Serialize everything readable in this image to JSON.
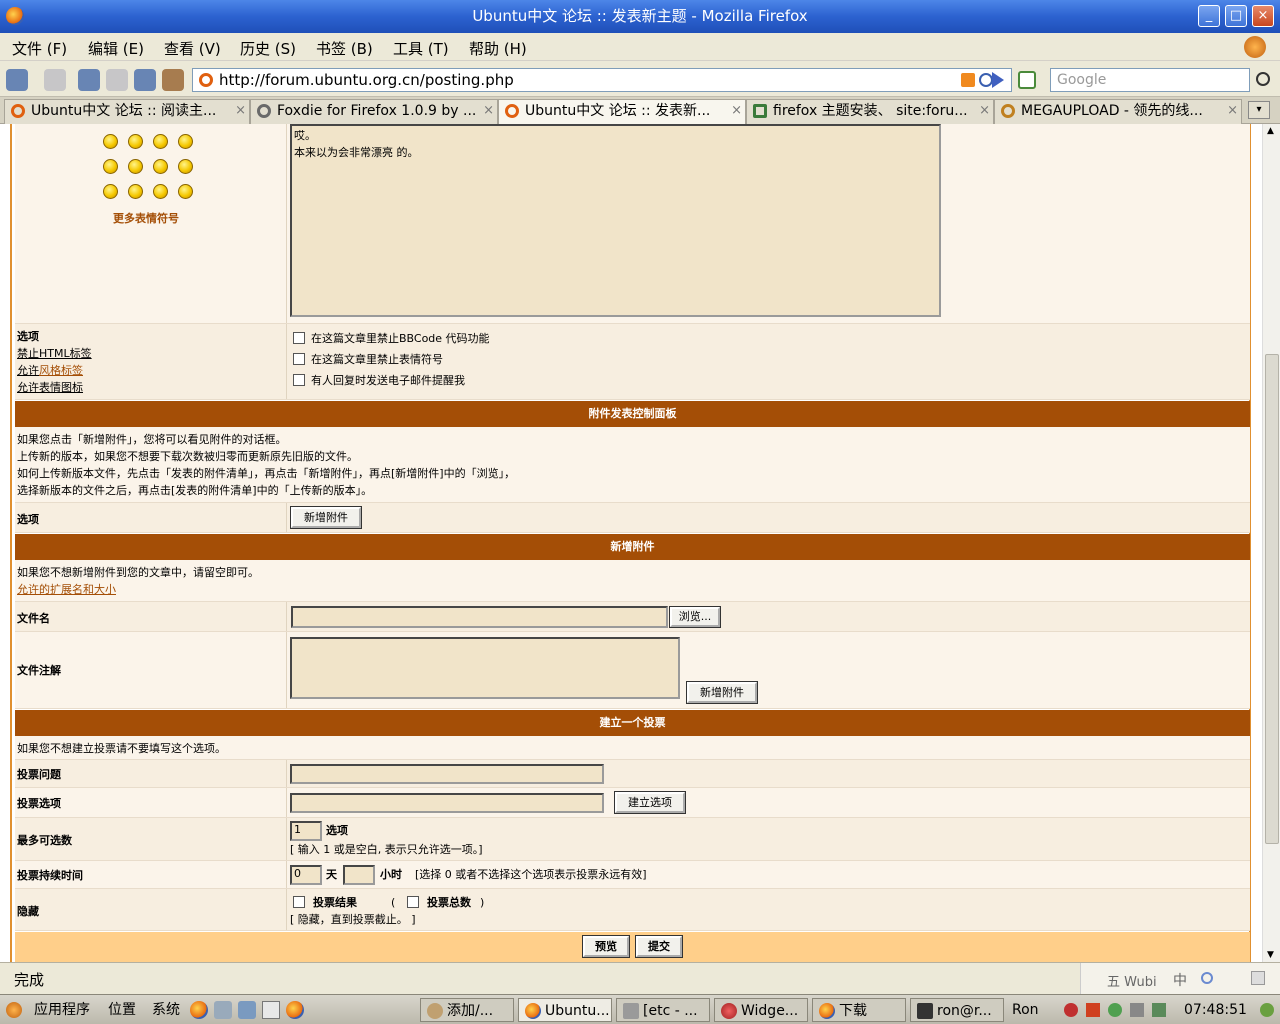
{
  "window": {
    "title": "Ubuntu中文 论坛 :: 发表新主题 - Mozilla Firefox"
  },
  "menu": [
    "文件 (F)",
    "编辑 (E)",
    "查看 (V)",
    "历史 (S)",
    "书签 (B)",
    "工具 (T)",
    "帮助 (H)"
  ],
  "nav": {
    "url": "http://forum.ubuntu.org.cn/posting.php",
    "search_placeholder": "Google"
  },
  "tabs": [
    {
      "label": "Ubuntu中文 论坛 :: 阅读主..."
    },
    {
      "label": "Foxdie for Firefox 1.0.9 by ..."
    },
    {
      "label": "Ubuntu中文 论坛 :: 发表新..."
    },
    {
      "label": "firefox 主题安装、 site:foru..."
    },
    {
      "label": "MEGAUPLOAD - 领先的线..."
    }
  ],
  "editor": {
    "text_line1": "哎。",
    "text_line2": "本来以为会非常漂亮  的。",
    "more_emoticons": "更多表情符号"
  },
  "options": {
    "label": "选项",
    "html": "禁止HTML标签",
    "bbcode_prefix": "允许",
    "bbcode_link": "风格标签",
    "smilies": "允许表情图标",
    "opt1": "在这篇文章里禁止BBCode 代码功能",
    "opt2": "在这篇文章里禁止表情符号",
    "opt3": "有人回复时发送电子邮件提醒我"
  },
  "attach_panel": {
    "header": "附件发表控制面板",
    "line1": "如果您点击「新增附件」，您将可以看见附件的对话框。",
    "line2": "上传新的版本，如果您不想要下载次数被归零而更新原先旧版的文件。",
    "line3": "如何上传新版本文件，先点击「发表的附件清单」，再点击「新增附件」，再点[新增附件]中的「浏览」，",
    "line4": "选择新版本的文件之后，再点击[发表的附件清单]中的「上传新的版本」。",
    "option_label": "选项",
    "add_button": "新增附件"
  },
  "new_attach": {
    "header": "新增附件",
    "hint": "如果您不想新增附件到您的文章中，请留空即可。",
    "ext_link": "允许的扩展名和大小",
    "filename_label": "文件名",
    "browse_button": "浏览...",
    "comment_label": "文件注解",
    "add_button": "新增附件"
  },
  "poll": {
    "header": "建立一个投票",
    "hint": "如果您不想建立投票请不要填写这个选项。",
    "question_label": "投票问题",
    "option_label": "投票选项",
    "add_option_button": "建立选项",
    "max_label": "最多可选数",
    "max_value": "1",
    "max_unit": "选项",
    "max_hint": "[ 输入 1 或是空白, 表示只允许选一项。]",
    "duration_label": "投票持续时间",
    "days_value": "0",
    "days_unit": "天",
    "hours_unit": "小时",
    "duration_hint": "[选择 0 或者不选择这个选项表示投票永远有效]",
    "hide_label": "隐藏",
    "hide_results": "投票结果",
    "open_paren": "(",
    "hide_total": "投票总数",
    "close_paren": ")",
    "hide_hint": "[ 隐藏，直到投票截止。 ]"
  },
  "submit": {
    "preview": "预览",
    "submit": "提交"
  },
  "status": {
    "text": "完成",
    "ime": "五 Wubi",
    "ime_zh": "中"
  },
  "taskbar": {
    "apps": "应用程序",
    "places": "位置",
    "system": "系统",
    "item1": "添加/...",
    "item2": "Ubuntu...",
    "item3": "[etc - ...",
    "item4": "Widge...",
    "item5": "下载",
    "item6": "ron@r...",
    "user": "Ron",
    "clock": "07:48:51"
  }
}
